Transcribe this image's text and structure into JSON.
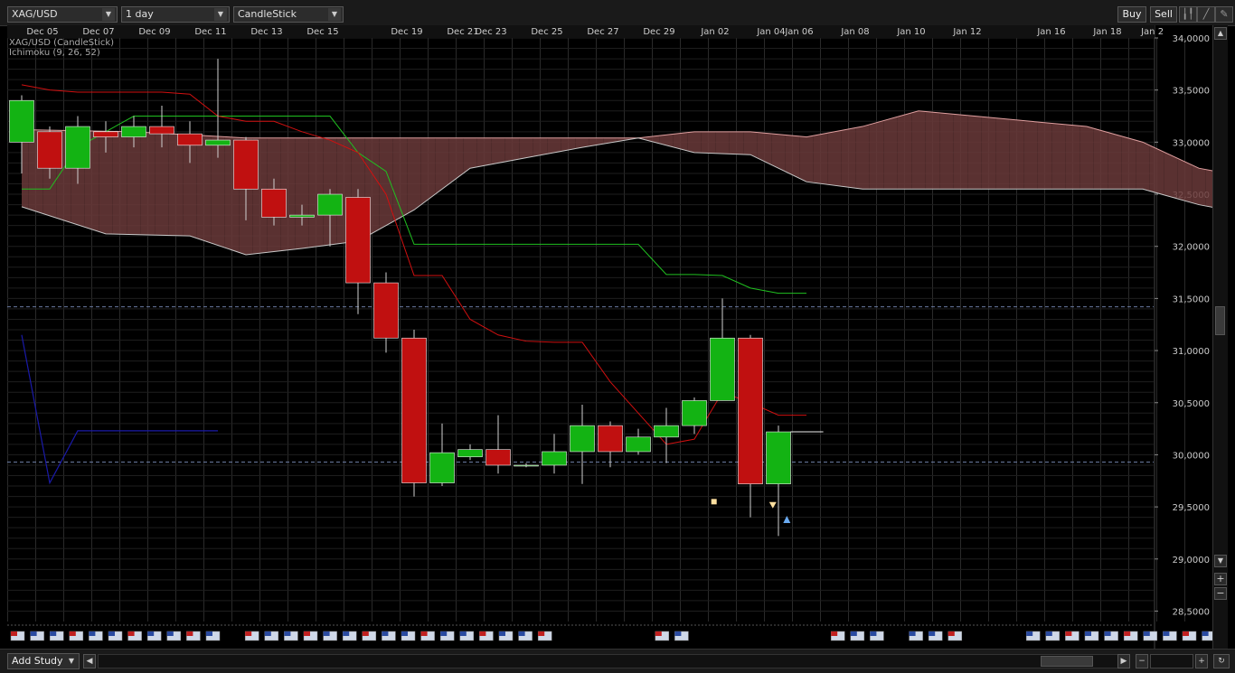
{
  "toolbar": {
    "symbol": "XAG/USD",
    "interval": "1 day",
    "chart_type": "CandleStick",
    "buy_label": "Buy",
    "sell_label": "Sell"
  },
  "legend": {
    "series_label": "XAG/USD (CandleStick)",
    "study_label": "Ichimoku (9, 26, 52)"
  },
  "bottom": {
    "add_study_label": "Add Study"
  },
  "colors": {
    "bull": "#13b313",
    "bear": "#c01010",
    "tenkan": "#d01010",
    "kijun": "#20c020",
    "chikou": "#1a1aa8",
    "cloud_bear": "#6a3a3a",
    "cloud_bull": "#3a3a3a",
    "grid": "#2a2a2a",
    "dashed": "#6a7aa0"
  },
  "chart_data": {
    "type": "candlestick",
    "x_labels": [
      "Dec 05",
      "Dec 07",
      "Dec 09",
      "Dec 11",
      "Dec 13",
      "Dec 15",
      "Dec 19",
      "Dec 21",
      "Dec 23",
      "Dec 25",
      "Dec 27",
      "Dec 29",
      "Jan 02",
      "Jan 04",
      "Jan 06",
      "Jan 08",
      "Jan 10",
      "Jan 12",
      "Jan 16",
      "Jan 18",
      "Jan 2"
    ],
    "y_ticks": [
      28.5,
      29.0,
      29.5,
      30.0,
      30.5,
      31.0,
      31.5,
      32.0,
      32.5,
      33.0,
      33.5,
      34.0
    ],
    "y_tick_labels": [
      "28,5000",
      "29,0000",
      "29,5000",
      "30,0000",
      "30,5000",
      "31,0000",
      "31,5000",
      "32,0000",
      "32,5000",
      "33,0000",
      "33,5000",
      "34,0000"
    ],
    "ylim": [
      28.4,
      34.0
    ],
    "x_slots": 43,
    "candles": [
      {
        "i": 0,
        "o": 33.0,
        "h": 33.45,
        "l": 32.7,
        "c": 33.4
      },
      {
        "i": 1,
        "o": 33.1,
        "h": 33.15,
        "l": 32.65,
        "c": 32.75
      },
      {
        "i": 2,
        "o": 32.75,
        "h": 33.25,
        "l": 32.6,
        "c": 33.15
      },
      {
        "i": 3,
        "o": 33.1,
        "h": 33.2,
        "l": 32.9,
        "c": 33.05
      },
      {
        "i": 4,
        "o": 33.05,
        "h": 33.25,
        "l": 32.95,
        "c": 33.15
      },
      {
        "i": 5,
        "o": 33.15,
        "h": 33.35,
        "l": 32.95,
        "c": 33.08
      },
      {
        "i": 6,
        "o": 33.08,
        "h": 33.2,
        "l": 32.8,
        "c": 32.97
      },
      {
        "i": 7,
        "o": 32.97,
        "h": 33.8,
        "l": 32.85,
        "c": 33.02
      },
      {
        "i": 8,
        "o": 33.02,
        "h": 33.05,
        "l": 32.25,
        "c": 32.55
      },
      {
        "i": 9,
        "o": 32.55,
        "h": 32.65,
        "l": 32.2,
        "c": 32.28
      },
      {
        "i": 10,
        "o": 32.28,
        "h": 32.4,
        "l": 32.2,
        "c": 32.3
      },
      {
        "i": 11,
        "o": 32.3,
        "h": 32.55,
        "l": 32.0,
        "c": 32.5
      },
      {
        "i": 12,
        "o": 32.47,
        "h": 32.55,
        "l": 31.35,
        "c": 31.65
      },
      {
        "i": 13,
        "o": 31.65,
        "h": 31.75,
        "l": 30.98,
        "c": 31.12
      },
      {
        "i": 14,
        "o": 31.12,
        "h": 31.2,
        "l": 29.6,
        "c": 29.73
      },
      {
        "i": 15,
        "o": 29.73,
        "h": 30.3,
        "l": 29.7,
        "c": 30.02
      },
      {
        "i": 16,
        "o": 29.98,
        "h": 30.1,
        "l": 29.95,
        "c": 30.05
      },
      {
        "i": 17,
        "o": 30.05,
        "h": 30.38,
        "l": 29.82,
        "c": 29.9
      },
      {
        "i": 18,
        "o": 29.9,
        "h": 29.92,
        "l": 29.88,
        "c": 29.9
      },
      {
        "i": 19,
        "o": 29.9,
        "h": 30.2,
        "l": 29.82,
        "c": 30.03
      },
      {
        "i": 20,
        "o": 30.03,
        "h": 30.48,
        "l": 29.72,
        "c": 30.28
      },
      {
        "i": 21,
        "o": 30.28,
        "h": 30.32,
        "l": 29.88,
        "c": 30.03
      },
      {
        "i": 22,
        "o": 30.03,
        "h": 30.25,
        "l": 30.0,
        "c": 30.17
      },
      {
        "i": 23,
        "o": 30.17,
        "h": 30.45,
        "l": 29.92,
        "c": 30.28
      },
      {
        "i": 24,
        "o": 30.28,
        "h": 30.55,
        "l": 30.2,
        "c": 30.52
      },
      {
        "i": 25,
        "o": 30.52,
        "h": 31.5,
        "l": 30.52,
        "c": 31.12
      },
      {
        "i": 26,
        "o": 31.12,
        "h": 31.15,
        "l": 29.4,
        "c": 29.72
      },
      {
        "i": 27,
        "o": 29.72,
        "h": 30.28,
        "l": 29.22,
        "c": 30.22
      }
    ],
    "tenkan": [
      [
        0,
        33.55
      ],
      [
        1,
        33.5
      ],
      [
        2,
        33.48
      ],
      [
        3,
        33.48
      ],
      [
        4,
        33.48
      ],
      [
        5,
        33.48
      ],
      [
        6,
        33.46
      ],
      [
        7,
        33.25
      ],
      [
        8,
        33.2
      ],
      [
        9,
        33.2
      ],
      [
        10,
        33.1
      ],
      [
        11,
        33.02
      ],
      [
        12,
        32.9
      ],
      [
        13,
        32.5
      ],
      [
        14,
        31.72
      ],
      [
        15,
        31.72
      ],
      [
        16,
        31.3
      ],
      [
        17,
        31.15
      ],
      [
        18,
        31.09
      ],
      [
        19,
        31.08
      ],
      [
        20,
        31.08
      ],
      [
        21,
        30.7
      ],
      [
        22,
        30.4
      ],
      [
        23,
        30.1
      ],
      [
        24,
        30.15
      ],
      [
        25,
        30.6
      ],
      [
        26,
        30.5
      ],
      [
        27,
        30.38
      ],
      [
        28,
        30.38
      ]
    ],
    "kijun": [
      [
        0,
        32.55
      ],
      [
        1,
        32.55
      ],
      [
        2,
        32.95
      ],
      [
        3,
        33.1
      ],
      [
        4,
        33.25
      ],
      [
        5,
        33.25
      ],
      [
        6,
        33.25
      ],
      [
        7,
        33.25
      ],
      [
        8,
        33.25
      ],
      [
        9,
        33.25
      ],
      [
        10,
        33.25
      ],
      [
        11,
        33.25
      ],
      [
        12,
        32.9
      ],
      [
        13,
        32.72
      ],
      [
        14,
        32.02
      ],
      [
        15,
        32.02
      ],
      [
        16,
        32.02
      ],
      [
        17,
        32.02
      ],
      [
        18,
        32.02
      ],
      [
        19,
        32.02
      ],
      [
        20,
        32.02
      ],
      [
        21,
        32.02
      ],
      [
        22,
        32.02
      ],
      [
        23,
        31.73
      ],
      [
        24,
        31.73
      ],
      [
        25,
        31.72
      ],
      [
        26,
        31.6
      ],
      [
        27,
        31.55
      ],
      [
        28,
        31.55
      ]
    ],
    "chikou": [
      [
        0,
        31.15
      ],
      [
        1,
        29.73
      ],
      [
        2,
        30.23
      ],
      [
        3,
        30.23
      ],
      [
        4,
        30.23
      ],
      [
        5,
        30.23
      ],
      [
        6,
        30.23
      ],
      [
        7,
        30.23
      ]
    ],
    "senkou_a": [
      [
        0,
        33.12
      ],
      [
        4,
        33.1
      ],
      [
        8,
        33.04
      ],
      [
        12,
        33.04
      ],
      [
        16,
        33.04
      ],
      [
        20,
        33.04
      ],
      [
        22,
        33.04
      ],
      [
        24,
        33.1
      ],
      [
        26,
        33.1
      ],
      [
        28,
        33.05
      ],
      [
        30,
        33.15
      ],
      [
        32,
        33.3
      ],
      [
        34,
        33.25
      ],
      [
        36,
        33.2
      ],
      [
        38,
        33.15
      ],
      [
        40,
        33.0
      ],
      [
        42,
        32.75
      ],
      [
        43,
        32.7
      ]
    ],
    "senkou_b": [
      [
        0,
        32.38
      ],
      [
        3,
        32.12
      ],
      [
        6,
        32.1
      ],
      [
        8,
        31.92
      ],
      [
        10,
        31.98
      ],
      [
        12,
        32.05
      ],
      [
        14,
        32.35
      ],
      [
        16,
        32.75
      ],
      [
        18,
        32.85
      ],
      [
        20,
        32.95
      ],
      [
        22,
        33.04
      ],
      [
        24,
        32.9
      ],
      [
        26,
        32.88
      ],
      [
        28,
        32.62
      ],
      [
        30,
        32.55
      ],
      [
        32,
        32.55
      ],
      [
        34,
        32.55
      ],
      [
        36,
        32.55
      ],
      [
        38,
        32.55
      ],
      [
        40,
        32.55
      ],
      [
        42,
        32.4
      ],
      [
        43,
        32.35
      ]
    ],
    "hlines": [
      31.42,
      29.93
    ],
    "current_price": 30.22,
    "markers": [
      {
        "type": "square",
        "x": 24.7,
        "y": 29.55
      },
      {
        "type": "triangle-down",
        "x": 26.8,
        "y": 29.52
      },
      {
        "type": "triangle-up",
        "x": 27.3,
        "y": 29.38
      }
    ]
  }
}
